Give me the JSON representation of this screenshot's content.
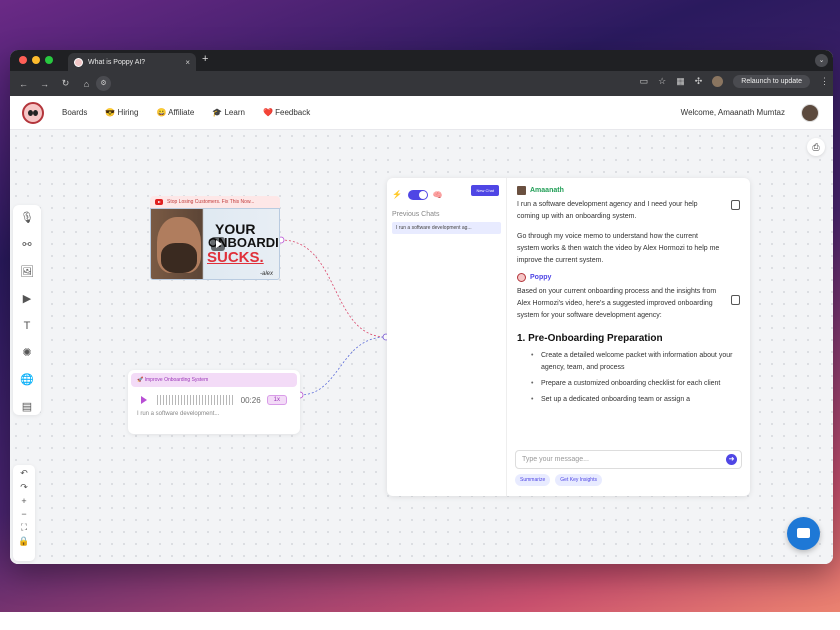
{
  "browser": {
    "tab_title": "What is Poppy AI?",
    "new_tab": "+",
    "close_tab": "×",
    "relaunch_label": "Relaunch to update",
    "tab_menu": "⌄"
  },
  "nav": {
    "links": [
      "Boards",
      "😎 Hiring",
      "😀 Affiliate",
      "🎓 Learn",
      "❤️ Feedback"
    ],
    "welcome": "Welcome, Amaanath Mumtaz"
  },
  "video": {
    "title": "Stop Losing Customers. Fix This Now...",
    "thumb_line1": "YOUR",
    "thumb_line2": "ONBOARDING",
    "thumb_line3": "SUCKS.",
    "thumb_sign": "-alex"
  },
  "audio": {
    "title": "🚀 Improve Onboarding System",
    "duration": "00:26",
    "speed": "1x",
    "preview": "I run a software development..."
  },
  "chat": {
    "new_chat": "New Chat",
    "previous_label": "Previous Chats",
    "previous_item": "I run a software development ag...",
    "user_name": "Amaanath",
    "user_msg1": "I run a software development agency and I need your help coming up with an onboarding system.",
    "user_msg2": "Go through my voice memo to understand how the current system works & then watch the video by Alex Hormozi to help me improve the current system.",
    "bot_name": "Poppy",
    "bot_msg": "Based on your current onboarding process and the insights from Alex Hormozi's video, here's a suggested improved onboarding system for your software development agency:",
    "section_title": "1. Pre-Onboarding Preparation",
    "bullets": [
      "Create a detailed welcome packet with information about your agency, team, and process",
      "Prepare a customized onboarding checklist for each client",
      "Set up a dedicated onboarding team or assign a"
    ],
    "input_placeholder": "Type your message...",
    "chip_summarize": "Summarize",
    "chip_insights": "Get Key Insights"
  },
  "colors": {
    "accent": "#4f46e5",
    "user_green": "#1f9d55",
    "audio_purple": "#9b37b8"
  }
}
